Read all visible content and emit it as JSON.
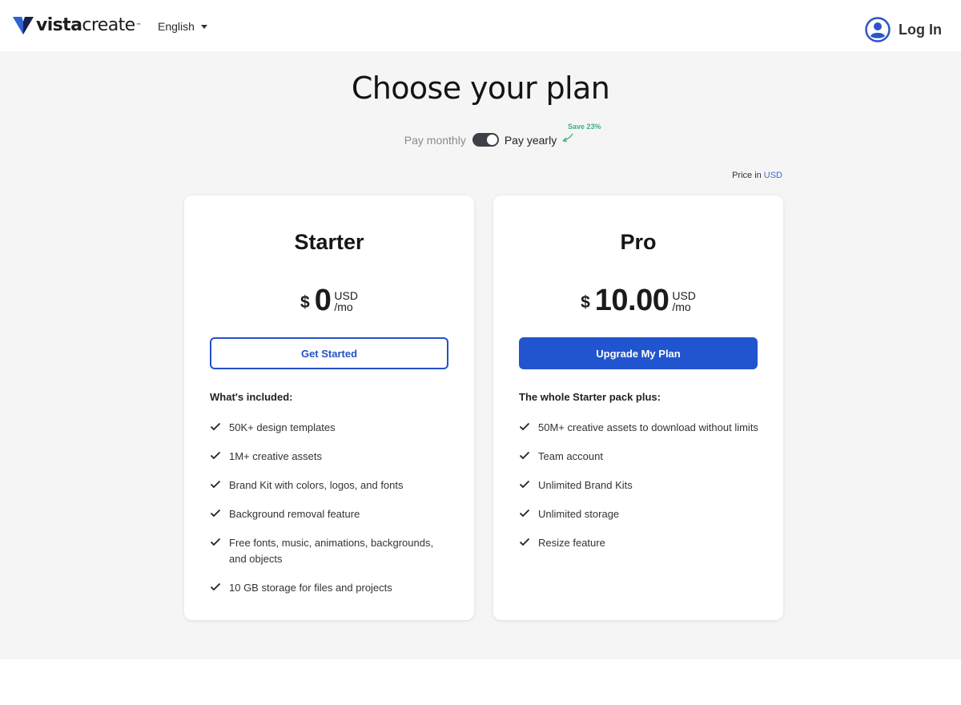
{
  "header": {
    "logo_bold": "vista",
    "logo_light": "create",
    "language": "English",
    "login_label": "Log In"
  },
  "page": {
    "title": "Choose your plan",
    "billing": {
      "monthly_label": "Pay monthly",
      "yearly_label": "Pay yearly",
      "selected": "yearly",
      "save_badge": "Save 23%"
    },
    "price_in_label": "Price in",
    "currency": "USD"
  },
  "plans": [
    {
      "name": "Starter",
      "currency_symbol": "$",
      "amount": "0",
      "unit_currency": "USD",
      "unit_period": "/mo",
      "cta": "Get Started",
      "included_heading": "What's included:",
      "features": [
        "50K+ design templates",
        "1M+ creative assets",
        "Brand Kit with colors, logos, and fonts",
        "Background removal feature",
        "Free fonts, music, animations, backgrounds, and objects",
        "10 GB storage for files and projects"
      ]
    },
    {
      "name": "Pro",
      "currency_symbol": "$",
      "amount": "10.00",
      "unit_currency": "USD",
      "unit_period": "/mo",
      "cta": "Upgrade My Plan",
      "included_heading": "The whole Starter pack plus:",
      "features": [
        "50M+ creative assets to download without limits",
        "Team account",
        "Unlimited Brand Kits",
        "Unlimited storage",
        "Resize feature"
      ]
    }
  ],
  "colors": {
    "accent_blue": "#2155cf",
    "save_green": "#3bb27c",
    "background": "#f5f5f5"
  }
}
